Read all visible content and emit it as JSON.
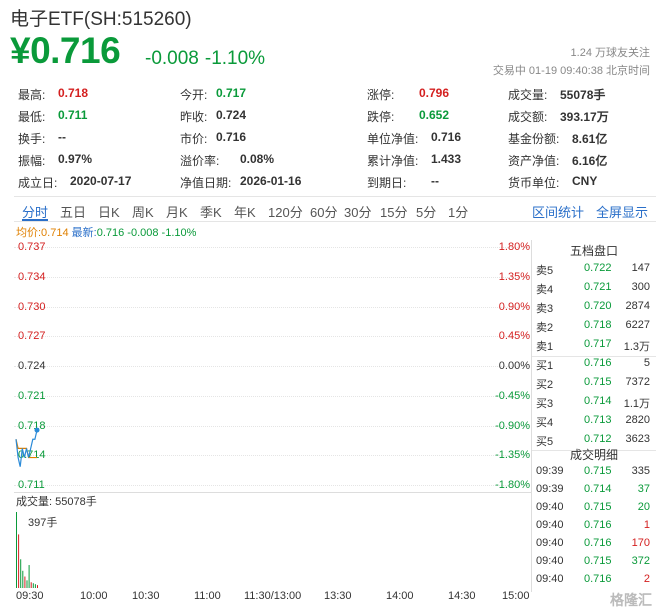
{
  "header": {
    "title": "电子ETF(SH:515260)",
    "price": "¥0.716",
    "change": "-0.008",
    "change_pct": "-1.10%",
    "followers": "1.24 万球友关注",
    "trade_status": "交易中 01-19 09:40:38 北京时间"
  },
  "stats": [
    [
      {
        "k": "最高:",
        "v": "0.718",
        "c": "red"
      },
      {
        "k": "今开:",
        "v": "0.717",
        "c": "green"
      },
      {
        "k": "涨停:",
        "v": "0.796",
        "c": "red"
      },
      {
        "k": "成交量:",
        "v": "55078手",
        "c": ""
      }
    ],
    [
      {
        "k": "最低:",
        "v": "0.711",
        "c": "green"
      },
      {
        "k": "昨收:",
        "v": "0.724",
        "c": ""
      },
      {
        "k": "跌停:",
        "v": "0.652",
        "c": "green"
      },
      {
        "k": "成交额:",
        "v": "393.17万",
        "c": ""
      }
    ],
    [
      {
        "k": "换手:",
        "v": "--",
        "c": ""
      },
      {
        "k": "市价:",
        "v": "0.716",
        "c": ""
      },
      {
        "k": "单位净值:",
        "v": "0.716",
        "c": ""
      },
      {
        "k": "基金份额:",
        "v": "8.61亿",
        "c": ""
      }
    ],
    [
      {
        "k": "振幅:",
        "v": "0.97%",
        "c": ""
      },
      {
        "k": "溢价率:",
        "v": "0.08%",
        "c": ""
      },
      {
        "k": "累计净值:",
        "v": "1.433",
        "c": ""
      },
      {
        "k": "资产净值:",
        "v": "6.16亿",
        "c": ""
      }
    ],
    [
      {
        "k": "成立日:",
        "v": "2020-07-17",
        "c": ""
      },
      {
        "k": "净值日期:",
        "v": "2026-01-16",
        "c": ""
      },
      {
        "k": "到期日:",
        "v": "--",
        "c": ""
      },
      {
        "k": "货币单位:",
        "v": "CNY",
        "c": ""
      }
    ]
  ],
  "tabs": [
    "分时",
    "五日",
    "日K",
    "周K",
    "月K",
    "季K",
    "年K",
    "120分",
    "60分",
    "30分",
    "15分",
    "5分",
    "1分"
  ],
  "tabs_right": [
    "区间统计",
    "全屏显示"
  ],
  "legend": {
    "avg": "均价:0.714",
    "last_label": "最新:",
    "last": "0.716 -0.008 -1.10%"
  },
  "chart_data": {
    "type": "line",
    "y_left": [
      "0.737",
      "0.734",
      "0.730",
      "0.727",
      "0.724",
      "0.721",
      "0.718",
      "0.714",
      "0.711"
    ],
    "y_right": [
      "1.80%",
      "1.35%",
      "0.90%",
      "0.45%",
      "0.00%",
      "-0.45%",
      "-0.90%",
      "-1.35%",
      "-1.80%"
    ],
    "x": [
      "09:30",
      "10:00",
      "10:30",
      "11:00",
      "11:30/13:00",
      "13:30",
      "14:00",
      "14:30",
      "15:00"
    ],
    "price_series": [
      0.716,
      0.714,
      0.713,
      0.715,
      0.714,
      0.715,
      0.714,
      0.715,
      0.716,
      0.716,
      0.717
    ],
    "avg_series": [
      0.716,
      0.715,
      0.715,
      0.715,
      0.715,
      0.715,
      0.714,
      0.714,
      0.714,
      0.714,
      0.714
    ],
    "volume_label": "成交量: 55078手",
    "volume_max": "397手",
    "volumes": [
      397,
      280,
      150,
      90,
      60,
      40,
      120,
      30,
      25,
      20,
      15
    ]
  },
  "orderbook": {
    "title": "五档盘口",
    "rows": [
      {
        "lbl": "卖5",
        "px": "0.722",
        "vol": "147"
      },
      {
        "lbl": "卖4",
        "px": "0.721",
        "vol": "300"
      },
      {
        "lbl": "卖3",
        "px": "0.720",
        "vol": "2874"
      },
      {
        "lbl": "卖2",
        "px": "0.718",
        "vol": "6227"
      },
      {
        "lbl": "卖1",
        "px": "0.717",
        "vol": "1.3万"
      },
      {
        "lbl": "买1",
        "px": "0.716",
        "vol": "5"
      },
      {
        "lbl": "买2",
        "px": "0.715",
        "vol": "7372"
      },
      {
        "lbl": "买3",
        "px": "0.714",
        "vol": "1.1万"
      },
      {
        "lbl": "买4",
        "px": "0.713",
        "vol": "2820"
      },
      {
        "lbl": "买5",
        "px": "0.712",
        "vol": "3623"
      }
    ],
    "ticks_title": "成交明细",
    "ticks": [
      {
        "t": "09:39",
        "px": "0.715",
        "vol": "335",
        "c": "#333"
      },
      {
        "t": "09:39",
        "px": "0.714",
        "vol": "37",
        "c": "#0a9a3a"
      },
      {
        "t": "09:40",
        "px": "0.715",
        "vol": "20",
        "c": "#0a9a3a"
      },
      {
        "t": "09:40",
        "px": "0.716",
        "vol": "1",
        "c": "#d42020"
      },
      {
        "t": "09:40",
        "px": "0.716",
        "vol": "170",
        "c": "#d42020"
      },
      {
        "t": "09:40",
        "px": "0.715",
        "vol": "372",
        "c": "#0a9a3a"
      },
      {
        "t": "09:40",
        "px": "0.716",
        "vol": "2",
        "c": "#d42020"
      }
    ]
  },
  "watermark": "格隆汇"
}
